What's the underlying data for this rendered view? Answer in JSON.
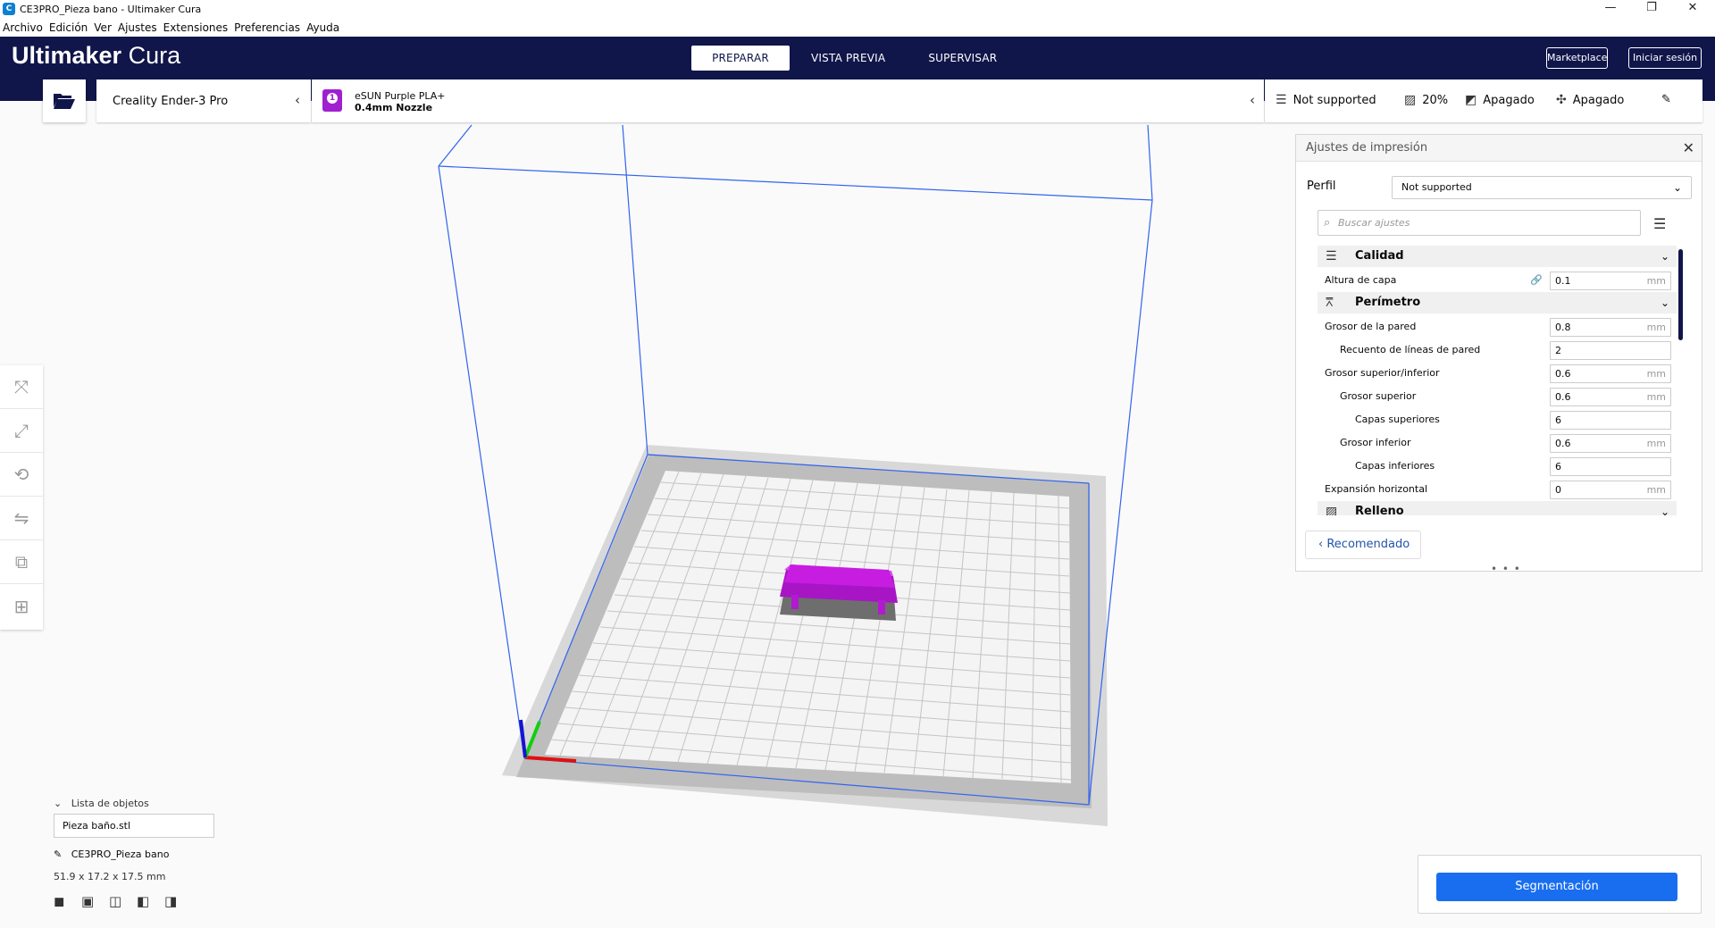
{
  "window": {
    "title": "CE3PRO_Pieza bano - Ultimaker Cura",
    "app_icon": "C",
    "minimize_icon": "—",
    "maximize_icon": "❐",
    "close_icon": "✕"
  },
  "menu": [
    "Archivo",
    "Edición",
    "Ver",
    "Ajustes",
    "Extensiones",
    "Preferencias",
    "Ayuda"
  ],
  "header": {
    "brand_bold": "Ultimaker",
    "brand_light": " Cura",
    "stages": [
      "PREPARAR",
      "VISTA PREVIA",
      "SUPERVISAR"
    ],
    "active_stage": "PREPARAR",
    "marketplace": "Marketplace",
    "login": "Iniciar sesión",
    "bg_color": "#10154a"
  },
  "toolbar": {
    "open_icon": "folder-open-icon",
    "printer": "Creality Ender-3 Pro",
    "extruder_number": "1",
    "material": "eSUN Purple PLA+",
    "nozzle": "0.4mm Nozzle",
    "profile": "Not supported",
    "infill": "20%",
    "support": "Apagado",
    "adhesion": "Apagado"
  },
  "print_settings": {
    "title": "Ajustes de impresión",
    "perfil_label": "Perfil",
    "perfil_value": "Not supported",
    "search_placeholder": "Buscar ajustes",
    "categories": {
      "calidad": "Calidad",
      "perimetro": "Perímetro",
      "relleno": "Relleno"
    },
    "rows": [
      {
        "label": "Altura de capa",
        "value": "0.1",
        "unit": "mm"
      },
      {
        "label": "Grosor de la pared",
        "value": "0.8",
        "unit": "mm"
      },
      {
        "label": "Recuento de líneas de pared",
        "value": "2",
        "unit": ""
      },
      {
        "label": "Grosor superior/inferior",
        "value": "0.6",
        "unit": "mm"
      },
      {
        "label": "Grosor superior",
        "value": "0.6",
        "unit": "mm"
      },
      {
        "label": "Capas superiores",
        "value": "6",
        "unit": ""
      },
      {
        "label": "Grosor inferior",
        "value": "0.6",
        "unit": "mm"
      },
      {
        "label": "Capas inferiores",
        "value": "6",
        "unit": ""
      },
      {
        "label": "Expansión horizontal",
        "value": "0",
        "unit": "mm"
      }
    ],
    "recommended": "Recomendado",
    "more": "• • •"
  },
  "objects": {
    "header": "Lista de objetos",
    "file": "Pieza baño.stl",
    "job_name": "CE3PRO_Pieza bano",
    "dimensions": "51.9 x 17.2 x 17.5 mm"
  },
  "slice_button": "Segmentación",
  "colors": {
    "accent": "#196ef0",
    "model": "#c71de0",
    "build_volume": "#3164f0"
  }
}
